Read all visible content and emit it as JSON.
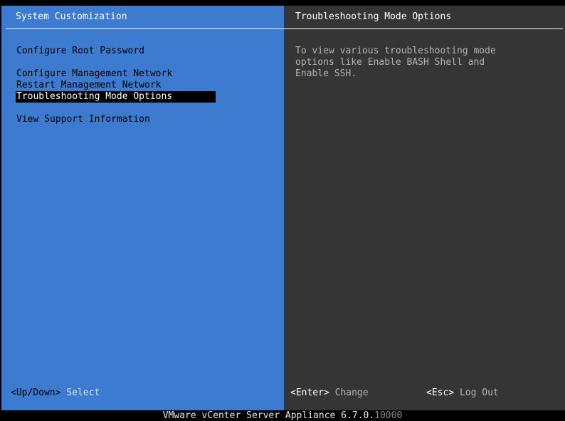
{
  "left_panel": {
    "title": "System Customization",
    "menu": [
      {
        "label": "Configure Root Password",
        "selected": false
      },
      {
        "label": "Configure Management Network",
        "selected": false
      },
      {
        "label": "Restart Management Network",
        "selected": false
      },
      {
        "label": "Troubleshooting Mode Options",
        "selected": true
      },
      {
        "label": "View Support Information",
        "selected": false
      }
    ],
    "hint": {
      "key": "<Up/Down>",
      "action": "Select"
    }
  },
  "right_panel": {
    "title": "Troubleshooting Mode Options",
    "description": "To view various troubleshooting mode\noptions like Enable BASH Shell and\nEnable SSH.",
    "hints": [
      {
        "key": "<Enter>",
        "action": "Change"
      },
      {
        "key": "<Esc>",
        "action": "Log Out"
      }
    ]
  },
  "footer": {
    "product": "VMware vCenter Server Appliance 6.7.0.",
    "build_obscured": "10000"
  },
  "colors": {
    "left_bg": "#3c7bd0",
    "right_bg": "#353535",
    "selection_bg": "#000000",
    "footer_bg": "#000000"
  }
}
